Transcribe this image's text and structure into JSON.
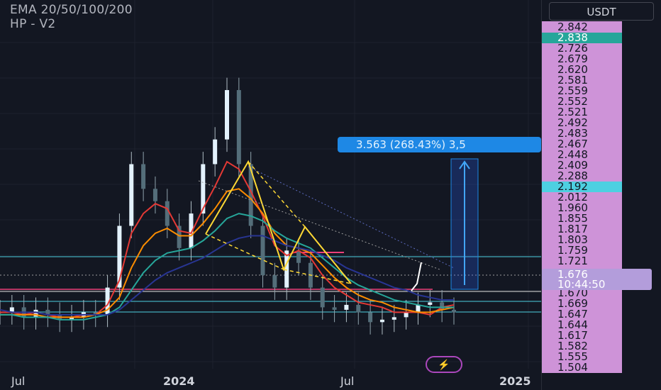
{
  "legend": {
    "line1": "EMA 20/50/100/200",
    "line2": "HP - V2"
  },
  "currency": "USDT",
  "price_labels": [
    "2.842",
    "2.838",
    "2.726",
    "2.679",
    "2.620",
    "2.581",
    "2.559",
    "2.552",
    "2.521",
    "2.492",
    "2.483",
    "2.467",
    "2.448",
    "2.409",
    "2.288",
    "2.192",
    "2.012",
    "1.960",
    "1.855",
    "1.817",
    "1.803",
    "1.759",
    "1.721",
    "1.676",
    "1.670",
    "1.669",
    "1.647",
    "1.644",
    "1.617",
    "1.582",
    "1.555",
    "1.504"
  ],
  "current_price": "1.676",
  "countdown": "10:44:50",
  "measure": {
    "label": "3.563 (268.43%) 3,5",
    "color": "#1e88e5"
  },
  "time_axis": {
    "labels": [
      {
        "text": "Jul",
        "bold": false
      },
      {
        "text": "2024",
        "bold": true
      },
      {
        "text": "Jul",
        "bold": false
      },
      {
        "text": "2025",
        "bold": true
      }
    ]
  },
  "colors": {
    "background": "#131722",
    "up": "#26a69a",
    "down": "#ef5350",
    "price_strip": "#ce93d8",
    "ema20": "#e53935",
    "ema50": "#fb8c00",
    "ema100": "#26a69a",
    "ema200": "#283593",
    "pattern_yellow": "#fdd835"
  },
  "icons": {
    "bolt": "lightning-icon"
  },
  "chart_data": {
    "type": "line",
    "title": "",
    "xlabel": "",
    "ylabel": "",
    "series": [
      {
        "name": "EMA 20",
        "values": [
          1.7,
          1.7,
          1.69,
          1.7,
          1.69,
          1.68,
          1.68,
          1.69,
          1.69,
          1.73,
          1.83,
          2.02,
          2.1,
          2.14,
          2.12,
          2.03,
          2.02,
          2.12,
          2.21,
          2.31,
          2.28,
          2.19,
          2.09,
          1.97,
          1.93,
          1.95,
          1.92,
          1.85,
          1.8,
          1.77,
          1.74,
          1.73,
          1.72,
          1.7,
          1.7,
          1.7,
          1.69,
          1.72,
          1.73
        ]
      },
      {
        "name": "EMA 50",
        "values": [
          1.69,
          1.69,
          1.69,
          1.69,
          1.68,
          1.68,
          1.68,
          1.68,
          1.69,
          1.71,
          1.76,
          1.88,
          1.97,
          2.02,
          2.04,
          2.01,
          2.01,
          2.06,
          2.12,
          2.19,
          2.2,
          2.16,
          2.1,
          2.02,
          1.97,
          1.96,
          1.94,
          1.89,
          1.84,
          1.8,
          1.77,
          1.75,
          1.74,
          1.72,
          1.71,
          1.7,
          1.7,
          1.71,
          1.72
        ]
      },
      {
        "name": "EMA 100",
        "values": [
          1.69,
          1.69,
          1.68,
          1.68,
          1.68,
          1.67,
          1.67,
          1.67,
          1.68,
          1.69,
          1.72,
          1.79,
          1.86,
          1.91,
          1.94,
          1.95,
          1.96,
          1.99,
          2.03,
          2.08,
          2.1,
          2.09,
          2.07,
          2.03,
          2.0,
          1.98,
          1.96,
          1.92,
          1.88,
          1.84,
          1.81,
          1.79,
          1.77,
          1.75,
          1.74,
          1.73,
          1.72,
          1.72,
          1.72
        ]
      },
      {
        "name": "EMA 200",
        "values": [
          1.71,
          1.7,
          1.7,
          1.7,
          1.69,
          1.69,
          1.69,
          1.69,
          1.69,
          1.69,
          1.71,
          1.75,
          1.79,
          1.83,
          1.86,
          1.88,
          1.9,
          1.92,
          1.95,
          1.98,
          2.0,
          2.01,
          2.01,
          1.99,
          1.97,
          1.96,
          1.95,
          1.93,
          1.91,
          1.88,
          1.86,
          1.84,
          1.82,
          1.8,
          1.79,
          1.77,
          1.76,
          1.75,
          1.75
        ]
      }
    ],
    "price": [
      1.7,
      1.72,
      1.68,
      1.71,
      1.69,
      1.67,
      1.68,
      1.7,
      1.69,
      1.8,
      2.05,
      2.3,
      2.2,
      2.15,
      2.05,
      1.96,
      2.1,
      2.3,
      2.4,
      2.6,
      2.3,
      2.05,
      1.85,
      1.8,
      1.95,
      1.9,
      1.8,
      1.72,
      1.71,
      1.73,
      1.7,
      1.66,
      1.67,
      1.68,
      1.7,
      1.73,
      1.74,
      1.71,
      1.7
    ],
    "ylim": [
      1.5,
      2.85
    ]
  }
}
